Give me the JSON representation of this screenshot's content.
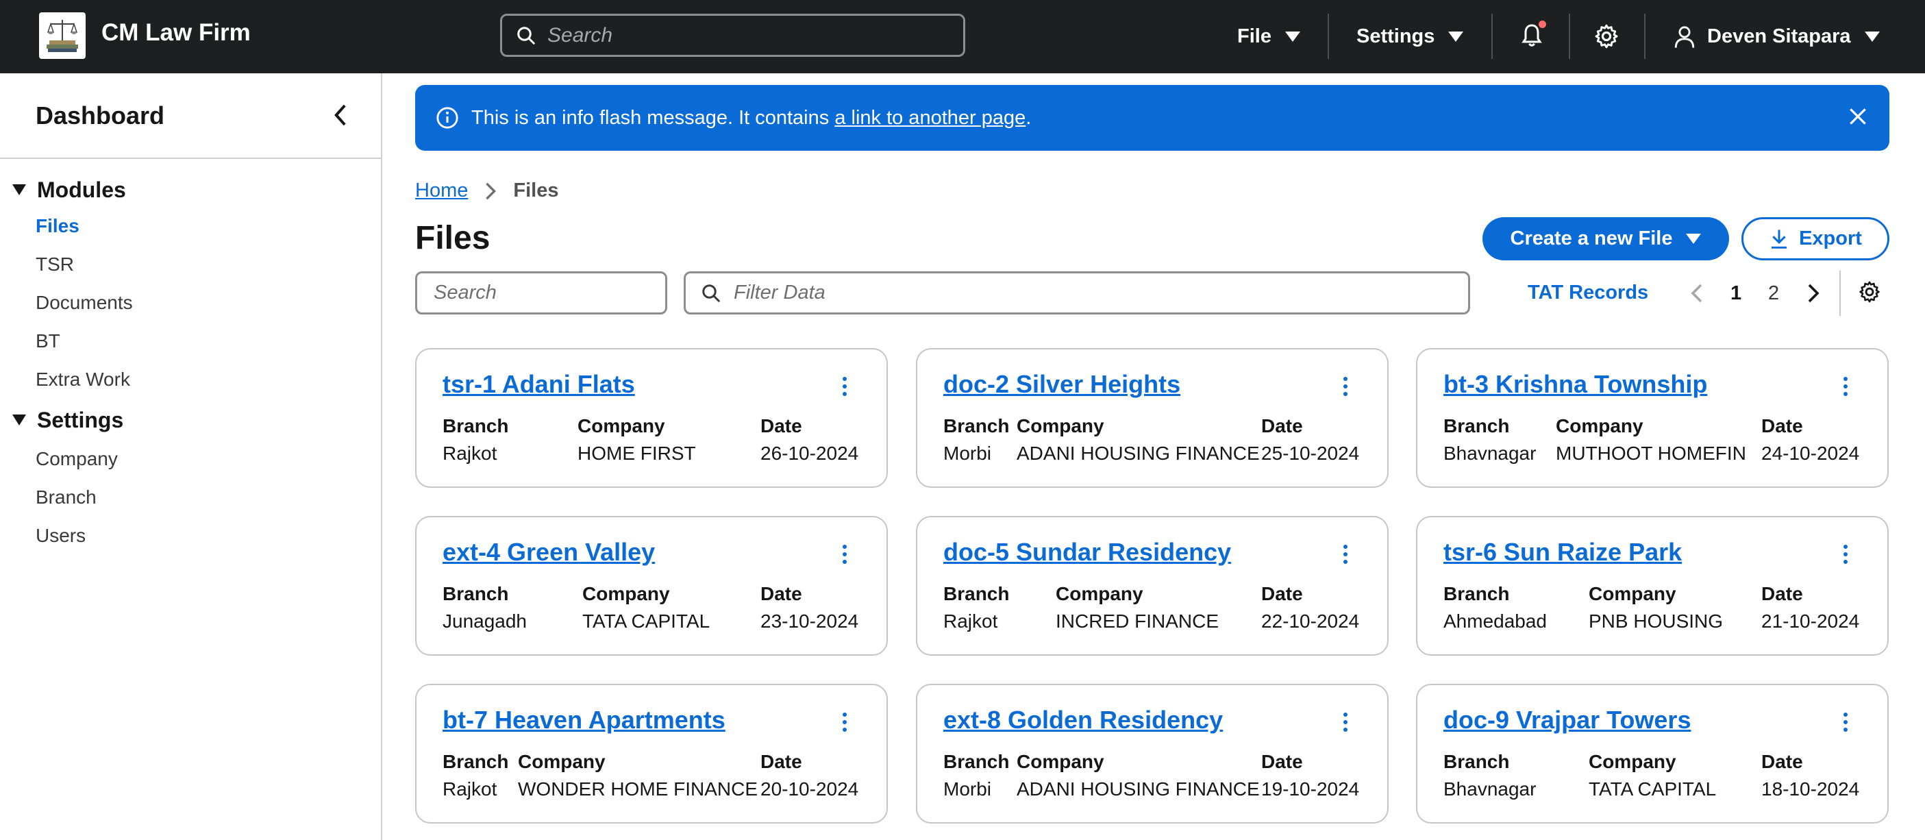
{
  "app": {
    "brand": "CM Law Firm"
  },
  "topbar": {
    "search_placeholder": "Search",
    "file_menu": "File",
    "settings_menu": "Settings",
    "user_name": "Deven Sitapara",
    "notification_dot_color": "#ff6b6b"
  },
  "sidebar": {
    "title": "Dashboard",
    "groups": [
      {
        "label": "Modules",
        "items": [
          "Files",
          "TSR",
          "Documents",
          "BT",
          "Extra Work"
        ],
        "active": "Files"
      },
      {
        "label": "Settings",
        "items": [
          "Company",
          "Branch",
          "Users"
        ]
      }
    ]
  },
  "flash": {
    "text_before": "This is an info flash message. It contains ",
    "link_text": "a link to another page",
    "text_after": "."
  },
  "breadcrumb": {
    "home": "Home",
    "current": "Files"
  },
  "page": {
    "title": "Files",
    "create_button": "Create a new File",
    "export_button": "Export",
    "search_placeholder": "Search",
    "filter_placeholder": "Filter Data",
    "tat_records": "TAT Records",
    "pages": [
      "1",
      "2"
    ],
    "current_page": "1"
  },
  "card_labels": {
    "branch": "Branch",
    "company": "Company",
    "date": "Date"
  },
  "cards": [
    {
      "title": "tsr-1 Adani Flats",
      "branch": "Rajkot",
      "company": "HOME FIRST",
      "date": "26-10-2024"
    },
    {
      "title": "doc-2 Silver Heights",
      "branch": "Morbi",
      "company": "ADANI HOUSING FINANCE",
      "date": "25-10-2024"
    },
    {
      "title": "bt-3 Krishna Township",
      "branch": "Bhavnagar",
      "company": "MUTHOOT HOMEFIN",
      "date": "24-10-2024"
    },
    {
      "title": "ext-4 Green Valley",
      "branch": "Junagadh",
      "company": "TATA CAPITAL",
      "date": "23-10-2024"
    },
    {
      "title": "doc-5 Sundar Residency",
      "branch": "Rajkot",
      "company": "INCRED FINANCE",
      "date": "22-10-2024"
    },
    {
      "title": "tsr-6 Sun Raize Park",
      "branch": "Ahmedabad",
      "company": "PNB HOUSING",
      "date": "21-10-2024"
    },
    {
      "title": "bt-7 Heaven Apartments",
      "branch": "Rajkot",
      "company": "WONDER HOME FINANCE",
      "date": "20-10-2024"
    },
    {
      "title": "ext-8 Golden Residency",
      "branch": "Morbi",
      "company": "ADANI HOUSING FINANCE",
      "date": "19-10-2024"
    },
    {
      "title": "doc-9 Vrajpar Towers",
      "branch": "Bhavnagar",
      "company": "TATA CAPITAL",
      "date": "18-10-2024"
    }
  ],
  "colors": {
    "accent": "#0b6bd6",
    "topbar": "#1d1f21"
  }
}
